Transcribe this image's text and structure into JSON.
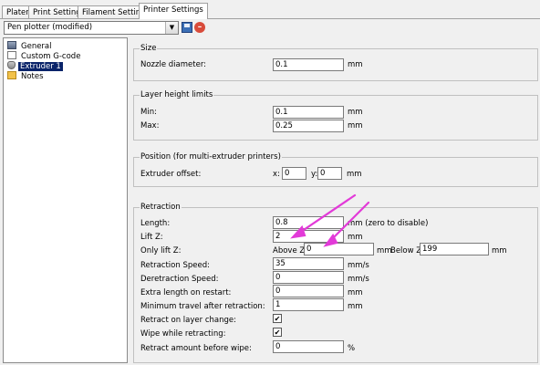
{
  "tabs": [
    {
      "label": "Plater"
    },
    {
      "label": "Print Settings"
    },
    {
      "label": "Filament Settings"
    },
    {
      "label": "Printer Settings"
    }
  ],
  "preset": {
    "value": "Pen plotter (modified)"
  },
  "tree": [
    {
      "label": "General"
    },
    {
      "label": "Custom G-code"
    },
    {
      "label": "Extruder 1"
    },
    {
      "label": "Notes"
    }
  ],
  "size": {
    "title": "Size",
    "nozzle_label": "Nozzle diameter:",
    "nozzle_value": "0.1",
    "nozzle_unit": "mm"
  },
  "layer": {
    "title": "Layer height limits",
    "min_label": "Min:",
    "min_value": "0.1",
    "min_unit": "mm",
    "max_label": "Max:",
    "max_value": "0.25",
    "max_unit": "mm"
  },
  "position": {
    "title": "Position (for multi-extruder printers)",
    "offset_label": "Extruder offset:",
    "x_label": "x:",
    "x_value": "0",
    "y_label": "y:",
    "y_value": "0",
    "unit": "mm"
  },
  "retraction": {
    "title": "Retraction",
    "length_label": "Length:",
    "length_value": "0.8",
    "length_unit": "mm (zero to disable)",
    "liftz_label": "Lift Z:",
    "liftz_value": "2",
    "liftz_unit": "mm",
    "onlylift_label": "Only lift Z:",
    "above_label": "Above Z:",
    "above_value": "0",
    "above_unit": "mm",
    "below_label": "Below Z:",
    "below_value": "199",
    "below_unit": "mm",
    "speed_label": "Retraction Speed:",
    "speed_value": "35",
    "speed_unit": "mm/s",
    "deretract_label": "Deretraction Speed:",
    "deretract_value": "0",
    "deretract_unit": "mm/s",
    "extra_label": "Extra length on restart:",
    "extra_value": "0",
    "extra_unit": "mm",
    "travel_label": "Minimum travel after retraction:",
    "travel_value": "1",
    "travel_unit": "mm",
    "layerchange_label": "Retract on layer change:",
    "layerchange_checked": true,
    "wipe_label": "Wipe while retracting:",
    "wipe_checked": true,
    "before_wipe_label": "Retract amount before wipe:",
    "before_wipe_value": "0",
    "before_wipe_unit": "%"
  },
  "checkmark": "✔",
  "colors": {
    "annotation_arrow": "#e23ad8",
    "selection": "#0a246a"
  }
}
